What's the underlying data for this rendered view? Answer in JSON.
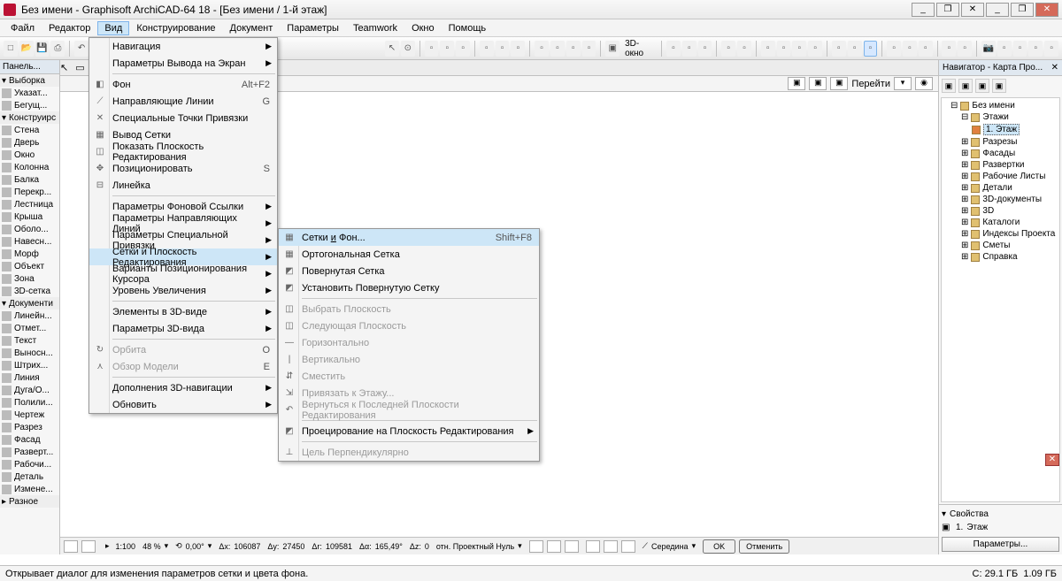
{
  "title": "Без имени - Graphisoft ArchiCAD-64 18 - [Без имени / 1-й этаж]",
  "menubar": [
    "Файл",
    "Редактор",
    "Вид",
    "Конструирование",
    "Документ",
    "Параметры",
    "Teamwork",
    "Окно",
    "Помощь"
  ],
  "toolbar": {
    "view3d": "3D-окно"
  },
  "rulerbar": {
    "goto": "Перейти"
  },
  "toolbox": {
    "header": "Панель...",
    "sub1": "Выборка",
    "sub2": "Конструирс",
    "sub3": "Документи",
    "sub4": "Разное",
    "tools_sel": [
      "Указат...",
      "Бегущ..."
    ],
    "tools_con": [
      "Стена",
      "Дверь",
      "Окно",
      "Колонна",
      "Балка",
      "Перекр...",
      "Лестница",
      "Крыша",
      "Оболо...",
      "Навесн...",
      "Морф",
      "Объект",
      "Зона",
      "3D-сетка"
    ],
    "tools_doc": [
      "Линейн...",
      "Отмет...",
      "Текст",
      "Выносн...",
      "Штрих...",
      "Линия",
      "Дуга/О...",
      "Полили...",
      "Чертеж",
      "Разрез",
      "Фасад",
      "Разверт...",
      "Рабочи...",
      "Деталь",
      "Измене..."
    ]
  },
  "navigator": {
    "title": "Навигатор - Карта Про...",
    "root": "Без имени",
    "nodes": [
      "Этажи",
      "Разрезы",
      "Фасады",
      "Развертки",
      "Рабочие Листы",
      "Детали",
      "3D-документы",
      "3D",
      "Каталоги",
      "Индексы Проекта",
      "Сметы",
      "Справка"
    ],
    "floor": "1. Этаж",
    "props_title": "Свойства",
    "props_floor_num": "1.",
    "props_floor_name": "Этаж",
    "params_btn": "Параметры..."
  },
  "menu1": {
    "items": [
      {
        "label": "Навигация",
        "arrow": true
      },
      {
        "label": "Параметры Вывода на Экран",
        "arrow": true
      },
      {
        "sep": true
      },
      {
        "label": "Фон",
        "sc": "Alt+F2",
        "ic": "◧"
      },
      {
        "label": "Направляющие Линии",
        "sc": "G",
        "ic": "⟋"
      },
      {
        "label": "Специальные Точки Привязки",
        "ic": "✕"
      },
      {
        "label": "Вывод Сетки",
        "ic": "▦"
      },
      {
        "label": "Показать Плоскость Редактирования",
        "ic": "◫"
      },
      {
        "label": "Позиционировать",
        "sc": "S",
        "ic": "✥"
      },
      {
        "label": "Линейка",
        "ic": "⊟"
      },
      {
        "sep": true
      },
      {
        "label": "Параметры Фоновой Ссылки",
        "arrow": true
      },
      {
        "label": "Параметры Направляющих Линий",
        "arrow": true
      },
      {
        "label": "Параметры Специальной Привязки",
        "arrow": true
      },
      {
        "label": "Сетки и Плоскость Редактирования",
        "arrow": true,
        "hl": true
      },
      {
        "label": "Варианты Позиционирования Курсора",
        "arrow": true
      },
      {
        "label": "Уровень Увеличения",
        "arrow": true
      },
      {
        "sep": true
      },
      {
        "label": "Элементы в 3D-виде",
        "arrow": true
      },
      {
        "label": "Параметры 3D-вида",
        "arrow": true
      },
      {
        "sep": true
      },
      {
        "label": "Орбита",
        "sc": "O",
        "dis": true,
        "ic": "↻"
      },
      {
        "label": "Обзор Модели",
        "sc": "E",
        "dis": true,
        "ic": "⋏"
      },
      {
        "sep": true
      },
      {
        "label": "Дополнения 3D-навигации",
        "arrow": true
      },
      {
        "label": "Обновить",
        "arrow": true
      }
    ]
  },
  "menu2": {
    "items": [
      {
        "html": "Сетки <u>и</u> Фон...",
        "sc": "Shift+F8",
        "hl": true,
        "ic": "▦"
      },
      {
        "label": "Ортогональная Сетка",
        "ic": "▦"
      },
      {
        "label": "Повернутая Сетка",
        "ic": "◩"
      },
      {
        "label": "Установить Повернутую Сетку",
        "ic": "◩"
      },
      {
        "sep": true
      },
      {
        "label": "Выбрать Плоскость",
        "dis": true,
        "ic": "◫"
      },
      {
        "label": "Следующая Плоскость",
        "dis": true,
        "ic": "◫"
      },
      {
        "label": "Горизонтально",
        "dis": true,
        "ic": "—"
      },
      {
        "label": "Вертикально",
        "dis": true,
        "ic": "|"
      },
      {
        "label": "Сместить",
        "dis": true,
        "ic": "⇵"
      },
      {
        "label": "Привязать к Этажу...",
        "dis": true,
        "ic": "⇲"
      },
      {
        "label": "Вернуться к Последней Плоскости Редактирования",
        "dis": true,
        "ic": "↶"
      },
      {
        "sep": true
      },
      {
        "label": "Проецирование на Плоскость Редактирования",
        "arrow": true,
        "ic": "◩"
      },
      {
        "sep": true
      },
      {
        "label": "Цель Перпендикулярно",
        "dis": true,
        "ic": "⊥"
      }
    ]
  },
  "bottom": {
    "scale": "1:100",
    "zoom": "48 %",
    "angle": "0,00°",
    "dx": "106087",
    "dy": "27450",
    "ax": "109581",
    "ay": "165,49°",
    "dz": "0",
    "ref": "отн. Проектный Нуль",
    "snap": "Середина",
    "ok": "OK",
    "cancel": "Отменить"
  },
  "status": {
    "hint": "Открывает диалог для изменения параметров сетки и цвета фона.",
    "right1": "C: 29.1 ГБ",
    "right2": "1.09 ГБ"
  }
}
